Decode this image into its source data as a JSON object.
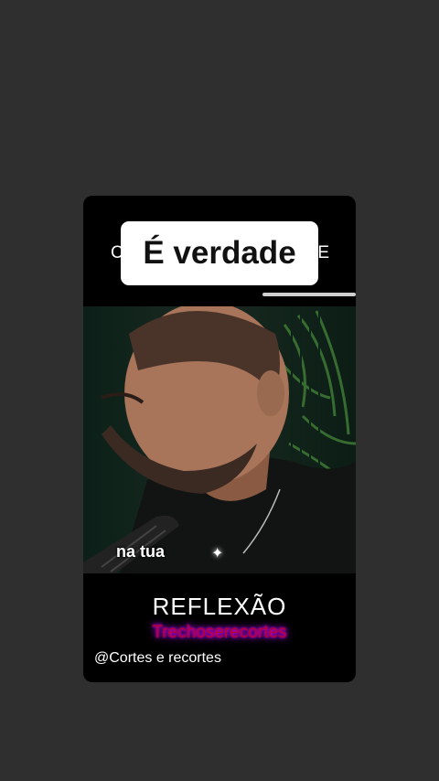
{
  "card": {
    "bubble_text": "É verdade",
    "background_title_left": "C",
    "background_title_right": "E",
    "caption_word": "na tua",
    "sparkle_glyph": "✦",
    "title": "REFLEXÃO",
    "subtitle": "Trechoserecortes",
    "handle": "@Cortes e recortes"
  },
  "colors": {
    "page_background": "#2f2f30",
    "card_background": "#000000",
    "subtitle_text": "#b4002f",
    "subtitle_glow": "#c000ff"
  },
  "icons": [
    "sparkle-icon"
  ]
}
